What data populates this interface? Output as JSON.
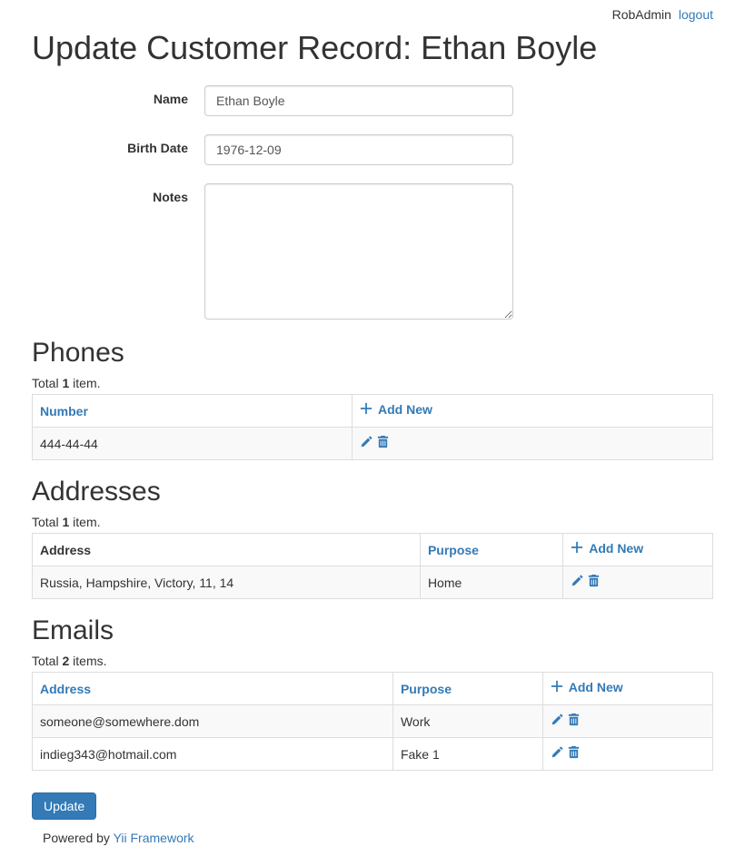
{
  "topbar": {
    "username": "RobAdmin",
    "logout_label": "logout"
  },
  "page_title": "Update Customer Record: Ethan Boyle",
  "form": {
    "name_label": "Name",
    "name_value": "Ethan Boyle",
    "birthdate_label": "Birth Date",
    "birthdate_value": "1976-12-09",
    "notes_label": "Notes",
    "notes_value": ""
  },
  "phones": {
    "heading": "Phones",
    "summary_prefix": "Total ",
    "summary_count": "1",
    "summary_suffix": " item.",
    "col_number": "Number",
    "add_new_label": "Add New",
    "rows": [
      {
        "number": "444-44-44"
      }
    ]
  },
  "addresses": {
    "heading": "Addresses",
    "summary_prefix": "Total ",
    "summary_count": "1",
    "summary_suffix": " item.",
    "col_address": "Address",
    "col_purpose": "Purpose",
    "add_new_label": "Add New",
    "rows": [
      {
        "address": "Russia, Hampshire, Victory, 11, 14",
        "purpose": "Home"
      }
    ]
  },
  "emails": {
    "heading": "Emails",
    "summary_prefix": "Total ",
    "summary_count": "2",
    "summary_suffix": " items.",
    "col_address": "Address",
    "col_purpose": "Purpose",
    "add_new_label": "Add New",
    "rows": [
      {
        "address": "someone@somewhere.dom",
        "purpose": "Work"
      },
      {
        "address": "indieg343@hotmail.com",
        "purpose": "Fake 1"
      }
    ]
  },
  "update_button_label": "Update",
  "footer": {
    "powered_by": "Powered by ",
    "link_text": "Yii Framework"
  }
}
